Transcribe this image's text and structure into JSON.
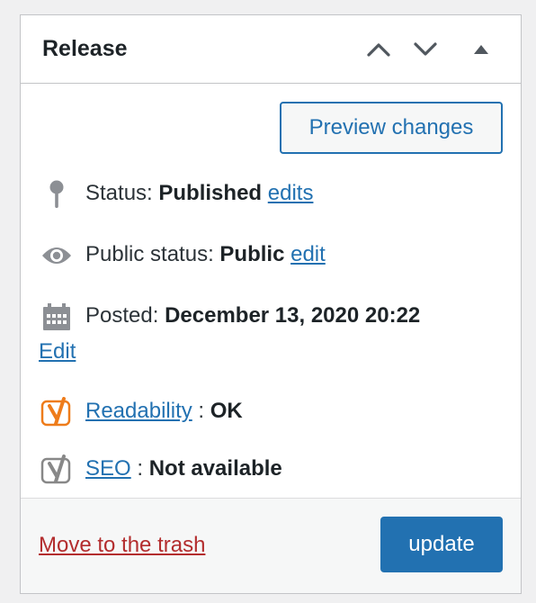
{
  "panel": {
    "title": "Release"
  },
  "header_controls": {
    "move_up": "chevron-up-icon",
    "move_down": "chevron-down-icon",
    "toggle": "triangle-up-icon"
  },
  "preview_button": "Preview changes",
  "status": {
    "label": "Status:",
    "value": "Published",
    "edit_link": "edits"
  },
  "visibility": {
    "label": "Public status:",
    "value": "Public",
    "edit_link": "edit"
  },
  "posted": {
    "label": "Posted:",
    "value": "December 13, 2020 20:22",
    "edit_link": "Edit"
  },
  "readability": {
    "link": "Readability",
    "separator": ":",
    "value": "OK"
  },
  "seo": {
    "link": "SEO",
    "separator": ":",
    "value": "Not available"
  },
  "footer": {
    "trash_link": "Move to the trash",
    "update_button": "update"
  },
  "colors": {
    "accent": "#2271b1",
    "danger": "#b32d2e",
    "yoast_ok": "#ee7c1b",
    "yoast_na": "#888888"
  }
}
